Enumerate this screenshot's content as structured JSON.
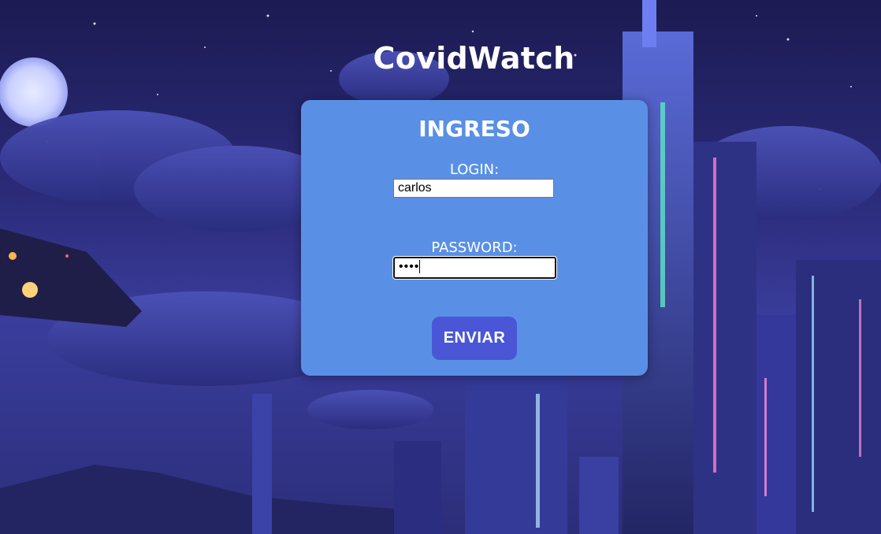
{
  "app": {
    "title": "CovidWatch"
  },
  "login_form": {
    "heading": "INGRESO",
    "login_label": "LOGIN:",
    "login_value": "carlos",
    "password_label": "PASSWORD:",
    "password_masked": "••••",
    "submit_label": "ENVIAR"
  },
  "colors": {
    "card_background": "#5990e6",
    "button_background": "#4a56d6",
    "text": "#ffffff"
  }
}
